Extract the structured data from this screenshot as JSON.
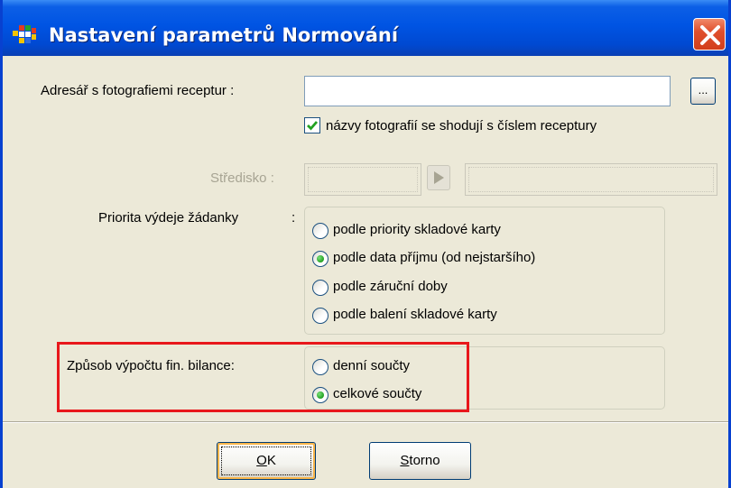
{
  "window": {
    "title": "Nastavení parametrů Normování",
    "close_label": "×"
  },
  "photo_dir": {
    "label": "Adresář s fotografiemi receptur :",
    "value": "",
    "browse_label": "...",
    "checkbox_label": "názvy fotografií se shodují s číslem receptury",
    "checkbox_checked": true
  },
  "stredisko": {
    "label": "Středisko :",
    "code_value": "",
    "name_value": ""
  },
  "priority": {
    "label": "Priorita výdeje žádanky",
    "colon": ":",
    "options": [
      {
        "label": "podle priority skladové karty",
        "selected": false
      },
      {
        "label": "podle data příjmu (od nejstaršího)",
        "selected": true
      },
      {
        "label": "podle záruční doby",
        "selected": false
      },
      {
        "label": "podle balení skladové karty",
        "selected": false
      }
    ]
  },
  "balance": {
    "label": "Způsob výpočtu fin. bilance:",
    "options": [
      {
        "label": "denní součty",
        "selected": false
      },
      {
        "label": "celkové součty",
        "selected": true
      }
    ]
  },
  "buttons": {
    "ok_accel": "O",
    "ok_rest": "K",
    "storno_accel": "S",
    "storno_rest": "torno"
  },
  "colors": {
    "title_bar": "#0054e3",
    "dialog_bg": "#ece9d8",
    "highlight_frame": "#e8171b",
    "radio_selected": "#21a121"
  },
  "icons": {
    "app": "app-grid-icon",
    "close": "close-icon",
    "check": "checkmark-icon",
    "arrow": "play-arrow-icon"
  }
}
